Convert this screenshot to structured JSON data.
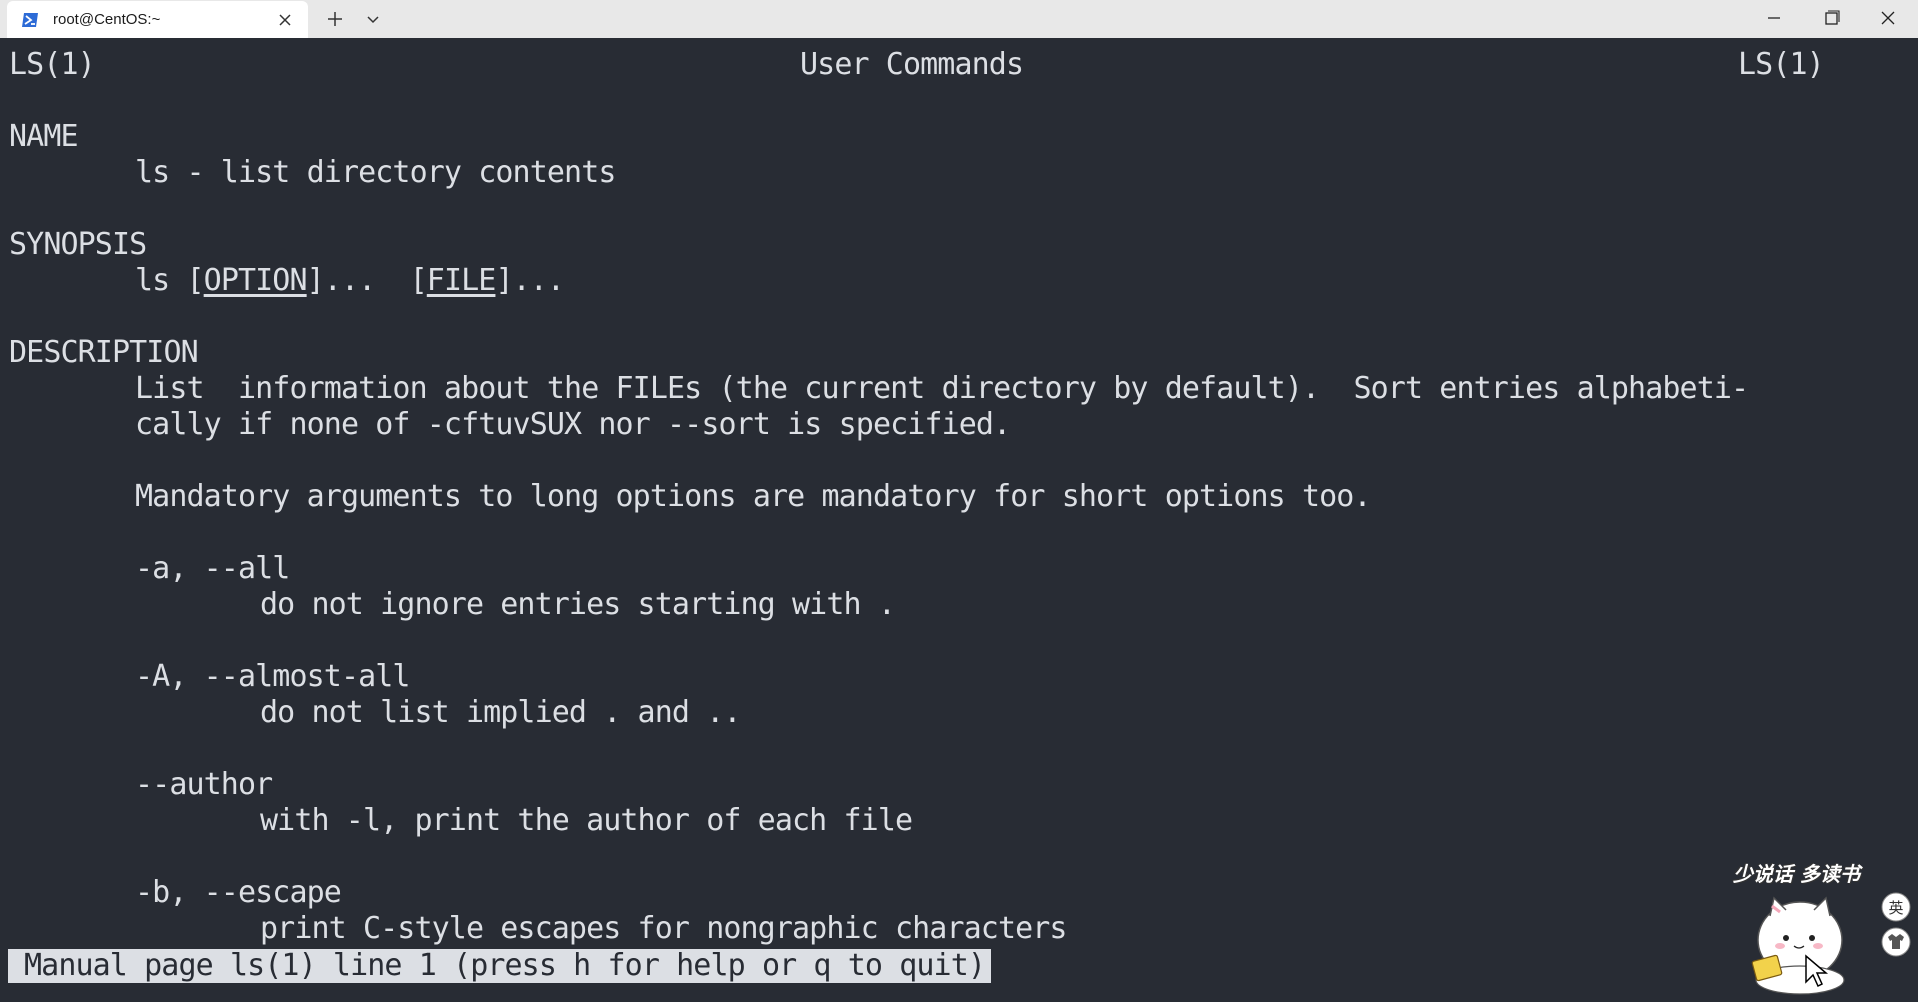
{
  "window": {
    "tab_title": "root@CentOS:~",
    "icons": {
      "tab": "powershell-icon",
      "close": "close-icon",
      "new_tab": "plus-icon",
      "dropdown": "chevron-down-icon",
      "minimize": "minimize-icon",
      "maximize": "maximize-icon",
      "window_close": "window-close-icon"
    }
  },
  "manpage": {
    "header_left": "LS(1)",
    "header_center": "User Commands",
    "header_right": "LS(1)",
    "name_heading": "NAME",
    "name_line": "ls - list directory contents",
    "synopsis_heading": "SYNOPSIS",
    "synopsis": {
      "cmd": "ls [",
      "option": "OPTION",
      "mid": "]...  [",
      "file": "FILE",
      "end": "]..."
    },
    "description_heading": "DESCRIPTION",
    "desc_line1": "List  information about the FILEs (the current directory by default).  Sort entries alphabeti-",
    "desc_line2": "cally if none of -cftuvSUX nor --sort is specified.",
    "mandatory": "Mandatory arguments to long options are mandatory for short options too.",
    "options": [
      {
        "flag": "-a, --all",
        "desc": "do not ignore entries starting with ."
      },
      {
        "flag": "-A, --almost-all",
        "desc": "do not list implied . and .."
      },
      {
        "flag": "--author",
        "desc": "with -l, print the author of each file"
      },
      {
        "flag": "-b, --escape",
        "desc": "print C-style escapes for nongraphic characters"
      }
    ]
  },
  "status_bar": "Manual page ls(1) line 1 (press h for help or q to quit)",
  "overlay": {
    "mascot_caption": "少说话 多读书",
    "ime_label": "英",
    "mascot_icon": "cat-mascot-icon",
    "shirt_icon": "shirt-icon"
  },
  "colors": {
    "background": "#282c34",
    "foreground": "#dcdfe4",
    "titlebar": "#e8e8e8"
  }
}
